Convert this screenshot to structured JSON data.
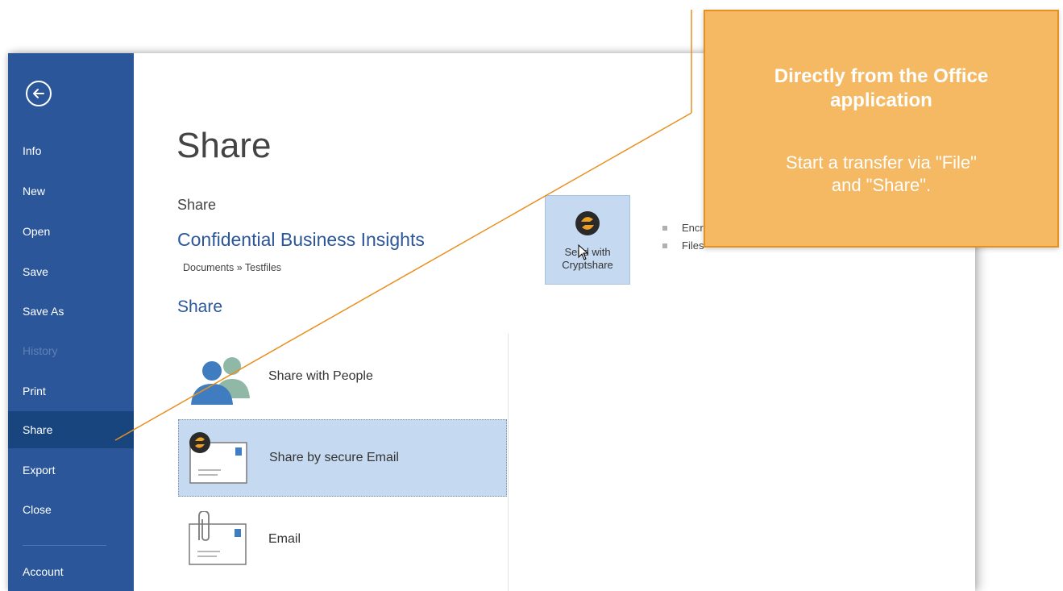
{
  "sidebar": {
    "items": [
      {
        "label": "Info"
      },
      {
        "label": "New"
      },
      {
        "label": "Open"
      },
      {
        "label": "Save"
      },
      {
        "label": "Save As"
      },
      {
        "label": "History"
      },
      {
        "label": "Print"
      },
      {
        "label": "Share"
      },
      {
        "label": "Export"
      },
      {
        "label": "Close"
      },
      {
        "label": "Account"
      }
    ]
  },
  "main": {
    "title": "Share",
    "subheading": "Share",
    "document_title": "Confidential Business Insights",
    "document_path": "Documents » Testfiles",
    "section_heading": "Share",
    "options": [
      {
        "label": "Share with People",
        "icon": "people-icon"
      },
      {
        "label": "Share by secure Email",
        "icon": "secure-email-icon"
      },
      {
        "label": "Email",
        "icon": "email-attachment-icon"
      }
    ],
    "send_tile": {
      "line1": "Send with",
      "line2": "Cryptshare",
      "icon": "cryptshare-logo-icon"
    },
    "bullets": [
      "Encr",
      "Files"
    ]
  },
  "callout": {
    "title_line1": "Directly from the Office",
    "title_line2": "application",
    "body_line1": "Start a transfer via \"File\"",
    "body_line2": "and \"Share\"."
  },
  "colors": {
    "sidebar": "#2b579a",
    "sidebar_selected": "#19457e",
    "selection": "#c5d9f1",
    "accent_blue": "#2b579a",
    "callout_fill": "#f5b963",
    "callout_border": "#e8901e",
    "cryptshare_orange": "#f0a020"
  }
}
